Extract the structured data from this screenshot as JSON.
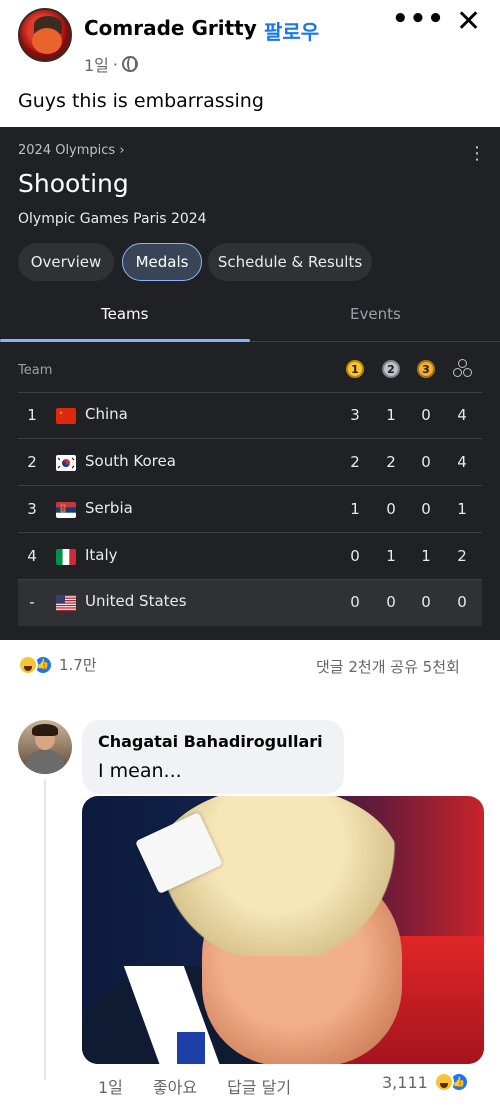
{
  "post": {
    "author": "Comrade Gritty",
    "separator": "·",
    "follow": "팔로우",
    "time": "1일",
    "meta_dot": "·",
    "text": "Guys this is embarrassing",
    "more_icon": "•••",
    "close_icon": "✕"
  },
  "card": {
    "breadcrumb": "2024 Olympics  ›",
    "menu_icon": "⋮",
    "title": "Shooting",
    "subtitle": "Olympic Games Paris 2024",
    "chips": [
      {
        "label": "Overview",
        "active": false
      },
      {
        "label": "Medals",
        "active": true
      },
      {
        "label": "Schedule & Results",
        "active": false
      }
    ],
    "tabs": [
      "Teams",
      "Events"
    ],
    "table_header": {
      "team": "Team",
      "gold": "1",
      "silver": "2",
      "bronze": "3"
    },
    "rows": [
      {
        "rank": "1",
        "country": "China",
        "gold": "3",
        "silver": "1",
        "bronze": "0",
        "total": "4"
      },
      {
        "rank": "2",
        "country": "South Korea",
        "gold": "2",
        "silver": "2",
        "bronze": "0",
        "total": "4"
      },
      {
        "rank": "3",
        "country": "Serbia",
        "gold": "1",
        "silver": "0",
        "bronze": "0",
        "total": "1"
      },
      {
        "rank": "4",
        "country": "Italy",
        "gold": "0",
        "silver": "1",
        "bronze": "1",
        "total": "2"
      },
      {
        "rank": "-",
        "country": "United States",
        "gold": "0",
        "silver": "0",
        "bronze": "0",
        "total": "0"
      }
    ]
  },
  "reactions": {
    "count": "1.7만",
    "stats": "댓글 2천개  공유 5천회"
  },
  "comment": {
    "author": "Chagatai Bahadirogullari",
    "text": "I mean...",
    "time": "1일",
    "like": "좋아요",
    "reply": "답글 달기",
    "react_count": "3,111"
  }
}
